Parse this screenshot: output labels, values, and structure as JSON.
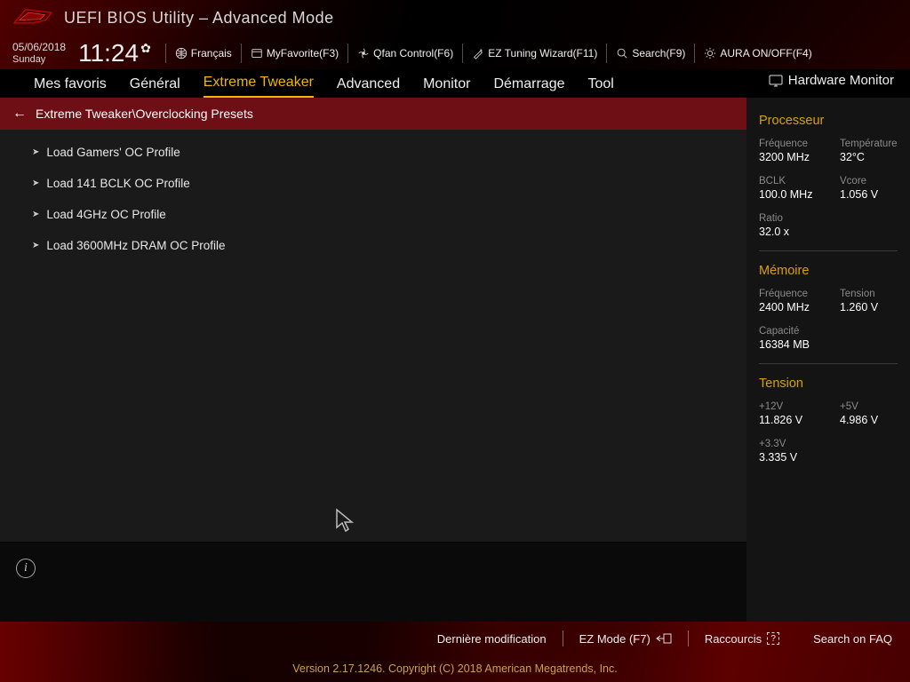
{
  "title": "UEFI BIOS Utility – Advanced Mode",
  "date": "05/06/2018",
  "day": "Sunday",
  "time": "11:24",
  "topbar": {
    "language": "Français",
    "favorite": "MyFavorite(F3)",
    "qfan": "Qfan Control(F6)",
    "eztuning": "EZ Tuning Wizard(F11)",
    "search": "Search(F9)",
    "aura": "AURA ON/OFF(F4)"
  },
  "tabs": [
    {
      "label": "Mes favoris"
    },
    {
      "label": "Général"
    },
    {
      "label": "Extreme Tweaker",
      "active": true
    },
    {
      "label": "Advanced"
    },
    {
      "label": "Monitor"
    },
    {
      "label": "Démarrage"
    },
    {
      "label": "Tool"
    }
  ],
  "hw_monitor_title": "Hardware Monitor",
  "breadcrumb": "Extreme Tweaker\\Overclocking Presets",
  "items": [
    "Load Gamers' OC Profile",
    "Load 141 BCLK OC Profile",
    "Load 4GHz OC Profile",
    "Load 3600MHz DRAM OC Profile"
  ],
  "sidebar": {
    "proc_title": "Processeur",
    "proc_freq_label": "Fréquence",
    "proc_freq": "3200 MHz",
    "proc_temp_label": "Température",
    "proc_temp": "32°C",
    "bclk_label": "BCLK",
    "bclk": "100.0 MHz",
    "vcore_label": "Vcore",
    "vcore": "1.056 V",
    "ratio_label": "Ratio",
    "ratio": "32.0 x",
    "mem_title": "Mémoire",
    "mem_freq_label": "Fréquence",
    "mem_freq": "2400 MHz",
    "mem_tension_label": "Tension",
    "mem_tension": "1.260 V",
    "capacity_label": "Capacité",
    "capacity": "16384 MB",
    "tension_title": "Tension",
    "v12_label": "+12V",
    "v12": "11.826 V",
    "v5_label": "+5V",
    "v5": "4.986 V",
    "v33_label": "+3.3V",
    "v33": "3.335 V"
  },
  "footer": {
    "last_mod": "Dernière modification",
    "ezmode": "EZ Mode (F7)",
    "shortcuts": "Raccourcis",
    "faq": "Search on FAQ",
    "copyright": "Version 2.17.1246. Copyright (C) 2018 American Megatrends, Inc."
  }
}
